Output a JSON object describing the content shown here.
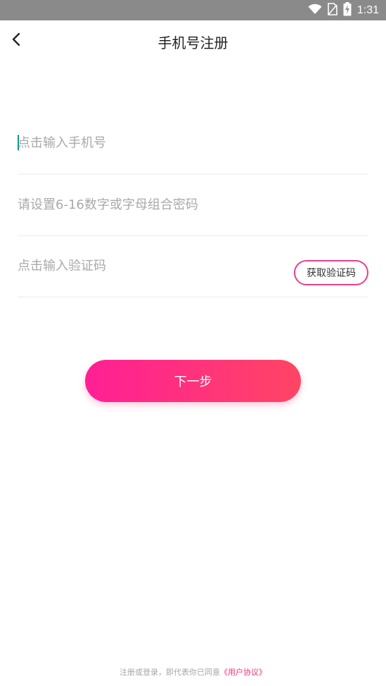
{
  "status_bar": {
    "time": "1:31",
    "icons": [
      "wifi-icon",
      "no-sim-icon",
      "battery-charging-icon"
    ]
  },
  "header": {
    "back_icon": "chevron-left-icon",
    "title": "手机号注册"
  },
  "form": {
    "phone_placeholder": "点击输入手机号",
    "phone_value": "",
    "password_placeholder": "请设置6-16数字或字母组合密码",
    "password_value": "",
    "code_placeholder": "点击输入验证码",
    "code_value": "",
    "get_code_label": "获取验证码"
  },
  "next_button": {
    "label": "下一步"
  },
  "footer": {
    "agreement_prefix": "注册或登录，即代表你已同意",
    "agreement_link": "《用户协议》"
  },
  "colors": {
    "status_bar": "#8a8a8a",
    "accent_pink": "#ea3f8c",
    "gradient_start": "#ff1f95",
    "gradient_end": "#ff4564",
    "caret": "#0d9a8c",
    "placeholder": "#a9a9a9"
  }
}
